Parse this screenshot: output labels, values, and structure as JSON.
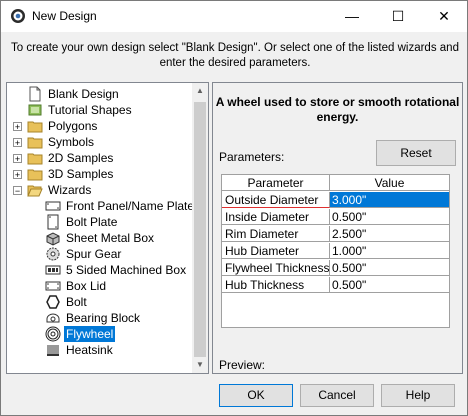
{
  "window": {
    "title": "New Design",
    "minimize_glyph": "—",
    "maximize_glyph": "☐",
    "close_glyph": "✕"
  },
  "instructions": "To create your own design select \"Blank Design\". Or select one of the listed wizards and enter the desired parameters.",
  "tree": {
    "items": [
      {
        "label": "Blank Design",
        "icon": "blank-page-icon",
        "level": 0,
        "expander": ""
      },
      {
        "label": "Tutorial Shapes",
        "icon": "tutorial-book-icon",
        "level": 0,
        "expander": ""
      },
      {
        "label": "Polygons",
        "icon": "folder-icon",
        "level": 0,
        "expander": "+"
      },
      {
        "label": "Symbols",
        "icon": "folder-icon",
        "level": 0,
        "expander": "+"
      },
      {
        "label": "2D Samples",
        "icon": "folder-icon",
        "level": 0,
        "expander": "+"
      },
      {
        "label": "3D Samples",
        "icon": "folder-icon",
        "level": 0,
        "expander": "+"
      },
      {
        "label": "Wizards",
        "icon": "open-folder-icon",
        "level": 0,
        "expander": "−"
      },
      {
        "label": "Front Panel/Name Plate/",
        "icon": "front-panel-icon",
        "level": 1,
        "expander": ""
      },
      {
        "label": "Bolt Plate",
        "icon": "bolt-plate-icon",
        "level": 1,
        "expander": ""
      },
      {
        "label": "Sheet Metal Box",
        "icon": "sheet-metal-box-icon",
        "level": 1,
        "expander": ""
      },
      {
        "label": "Spur Gear",
        "icon": "gear-icon",
        "level": 1,
        "expander": ""
      },
      {
        "label": "5 Sided Machined Box",
        "icon": "machined-box-icon",
        "level": 1,
        "expander": ""
      },
      {
        "label": "Box Lid",
        "icon": "box-lid-icon",
        "level": 1,
        "expander": ""
      },
      {
        "label": "Bolt",
        "icon": "hexagon-bolt-icon",
        "level": 1,
        "expander": ""
      },
      {
        "label": "Bearing Block",
        "icon": "bearing-block-icon",
        "level": 1,
        "expander": ""
      },
      {
        "label": "Flywheel",
        "icon": "flywheel-icon",
        "level": 1,
        "expander": ""
      },
      {
        "label": "Heatsink",
        "icon": "heatsink-icon",
        "level": 1,
        "expander": ""
      }
    ],
    "selected_index": 15
  },
  "details": {
    "description": "A wheel used to store or smooth rotational energy.",
    "parameters_label": "Parameters:",
    "reset_label": "Reset",
    "grid_headers": {
      "name": "Parameter",
      "value": "Value"
    },
    "params": [
      {
        "name": "Outside Diameter",
        "value": "3.000\""
      },
      {
        "name": "Inside Diameter",
        "value": "0.500\""
      },
      {
        "name": "Rim Diameter",
        "value": "2.500\""
      },
      {
        "name": "Hub Diameter",
        "value": "1.000\""
      },
      {
        "name": "Flywheel Thickness",
        "value": "0.500\""
      },
      {
        "name": "Hub Thickness",
        "value": "0.500\""
      }
    ],
    "selected_param_index": 0,
    "preview_label": "Preview:"
  },
  "buttons": {
    "ok": "OK",
    "cancel": "Cancel",
    "help": "Help"
  },
  "colors": {
    "selection": "#0078d7",
    "folder": "#e8c15a"
  }
}
